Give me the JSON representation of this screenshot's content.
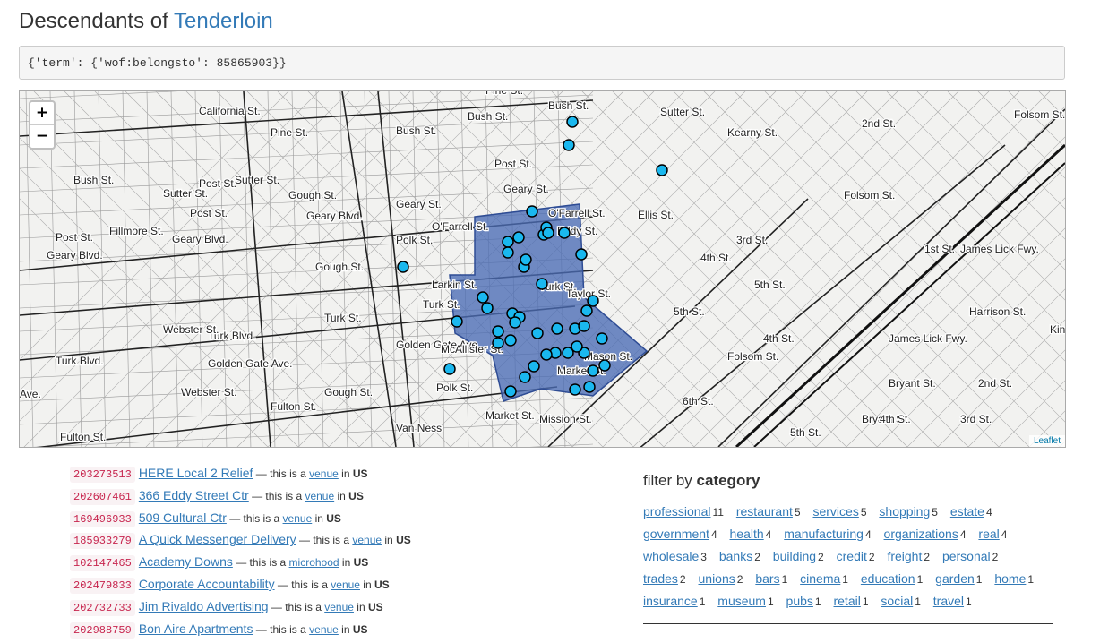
{
  "title": {
    "prefix": "Descendants of",
    "place": "Tenderloin"
  },
  "query": "{'term': {'wof:belongsto': 85865903}}",
  "map": {
    "zoom_in": "+",
    "zoom_out": "−",
    "attribution": "Leaflet",
    "street_labels": [
      "Pine St.",
      "California St.",
      "Pine St.",
      "Bush St.",
      "Bush St.",
      "Bush St.",
      "Sutter St.",
      "Post St.",
      "Bush St.",
      "Post St.",
      "Geary St.",
      "Sutter St.",
      "Sutter St.",
      "Post St.",
      "Geary Blvd.",
      "Geary St.",
      "O'Farrell St.",
      "O'Farrell St.",
      "Ellis St.",
      "Geary Blvd.",
      "Post St.",
      "Geary Blvd.",
      "Turk St.",
      "Turk St.",
      "Turk St.",
      "Turk Blvd.",
      "Turk Blvd.",
      "Golden Gate Ave.",
      "Golden Gate Ave.",
      "McAllister St.",
      "Fulton St.",
      "Fulton St.",
      "Market St.",
      "Mission St.",
      "Market St.",
      "Fillmore St.",
      "Webster St.",
      "Webster St.",
      "Gough St.",
      "Gough St.",
      "Gough St.",
      "Polk St.",
      "Polk St.",
      "Larkin St.",
      "Van Ness",
      "Kearny St.",
      "3rd St.",
      "4th St.",
      "5th St.",
      "5th St.",
      "6th St.",
      "6th St.",
      "4th St.",
      "Folsom St.",
      "Folsom St.",
      "2nd St.",
      "1st St.",
      "Harrison St.",
      "Bryant St.",
      "Bryant St.",
      "James Lick Fwy.",
      "James Lick Fwy.",
      "3rd St.",
      "4th St.",
      "5th St.",
      "2nd St.",
      "3rd St.",
      "King St.",
      "Folsom St.",
      "Ave.",
      "Eddy St.",
      "Taylor St.",
      "Mason St."
    ]
  },
  "records": [
    {
      "id": "203273513",
      "name": "HERE Local 2 Relief",
      "sep": " — this is a ",
      "type": "venue",
      "in": " in ",
      "country": "US"
    },
    {
      "id": "202607461",
      "name": "366 Eddy Street Ctr",
      "sep": " — this is a ",
      "type": "venue",
      "in": " in ",
      "country": "US"
    },
    {
      "id": "169496933",
      "name": "509 Cultural Ctr",
      "sep": " — this is a ",
      "type": "venue",
      "in": " in ",
      "country": "US"
    },
    {
      "id": "185933279",
      "name": "A Quick Messenger Delivery",
      "sep": " — this is a ",
      "type": "venue",
      "in": " in ",
      "country": "US"
    },
    {
      "id": "102147465",
      "name": "Academy Downs",
      "sep": " — this is a ",
      "type": "microhood",
      "in": " in ",
      "country": "US"
    },
    {
      "id": "202479833",
      "name": "Corporate Accountability",
      "sep": " — this is a ",
      "type": "venue",
      "in": " in ",
      "country": "US"
    },
    {
      "id": "202732733",
      "name": "Jim Rivaldo Advertising",
      "sep": " — this is a ",
      "type": "venue",
      "in": " in ",
      "country": "US"
    },
    {
      "id": "202988759",
      "name": "Bon Aire Apartments",
      "sep": " — this is a ",
      "type": "venue",
      "in": " in ",
      "country": "US"
    }
  ],
  "filter": {
    "label": "filter by",
    "label_bold": "category",
    "categories": [
      {
        "name": "professional",
        "count": "11"
      },
      {
        "name": "restaurant",
        "count": "5"
      },
      {
        "name": "services",
        "count": "5"
      },
      {
        "name": "shopping",
        "count": "5"
      },
      {
        "name": "estate",
        "count": "4"
      },
      {
        "name": "government",
        "count": "4"
      },
      {
        "name": "health",
        "count": "4"
      },
      {
        "name": "manufacturing",
        "count": "4"
      },
      {
        "name": "organizations",
        "count": "4"
      },
      {
        "name": "real",
        "count": "4"
      },
      {
        "name": "wholesale",
        "count": "3"
      },
      {
        "name": "banks",
        "count": "2"
      },
      {
        "name": "building",
        "count": "2"
      },
      {
        "name": "credit",
        "count": "2"
      },
      {
        "name": "freight",
        "count": "2"
      },
      {
        "name": "personal",
        "count": "2"
      },
      {
        "name": "trades",
        "count": "2"
      },
      {
        "name": "unions",
        "count": "2"
      },
      {
        "name": "bars",
        "count": "1"
      },
      {
        "name": "cinema",
        "count": "1"
      },
      {
        "name": "education",
        "count": "1"
      },
      {
        "name": "garden",
        "count": "1"
      },
      {
        "name": "home",
        "count": "1"
      },
      {
        "name": "insurance",
        "count": "1"
      },
      {
        "name": "museum",
        "count": "1"
      },
      {
        "name": "pubs",
        "count": "1"
      },
      {
        "name": "retail",
        "count": "1"
      },
      {
        "name": "social",
        "count": "1"
      },
      {
        "name": "travel",
        "count": "1"
      }
    ]
  },
  "colors": {
    "link": "#337ab7",
    "polygon": "#4a6bb5",
    "marker": "#1ab8ef",
    "code": "#c7254e"
  }
}
